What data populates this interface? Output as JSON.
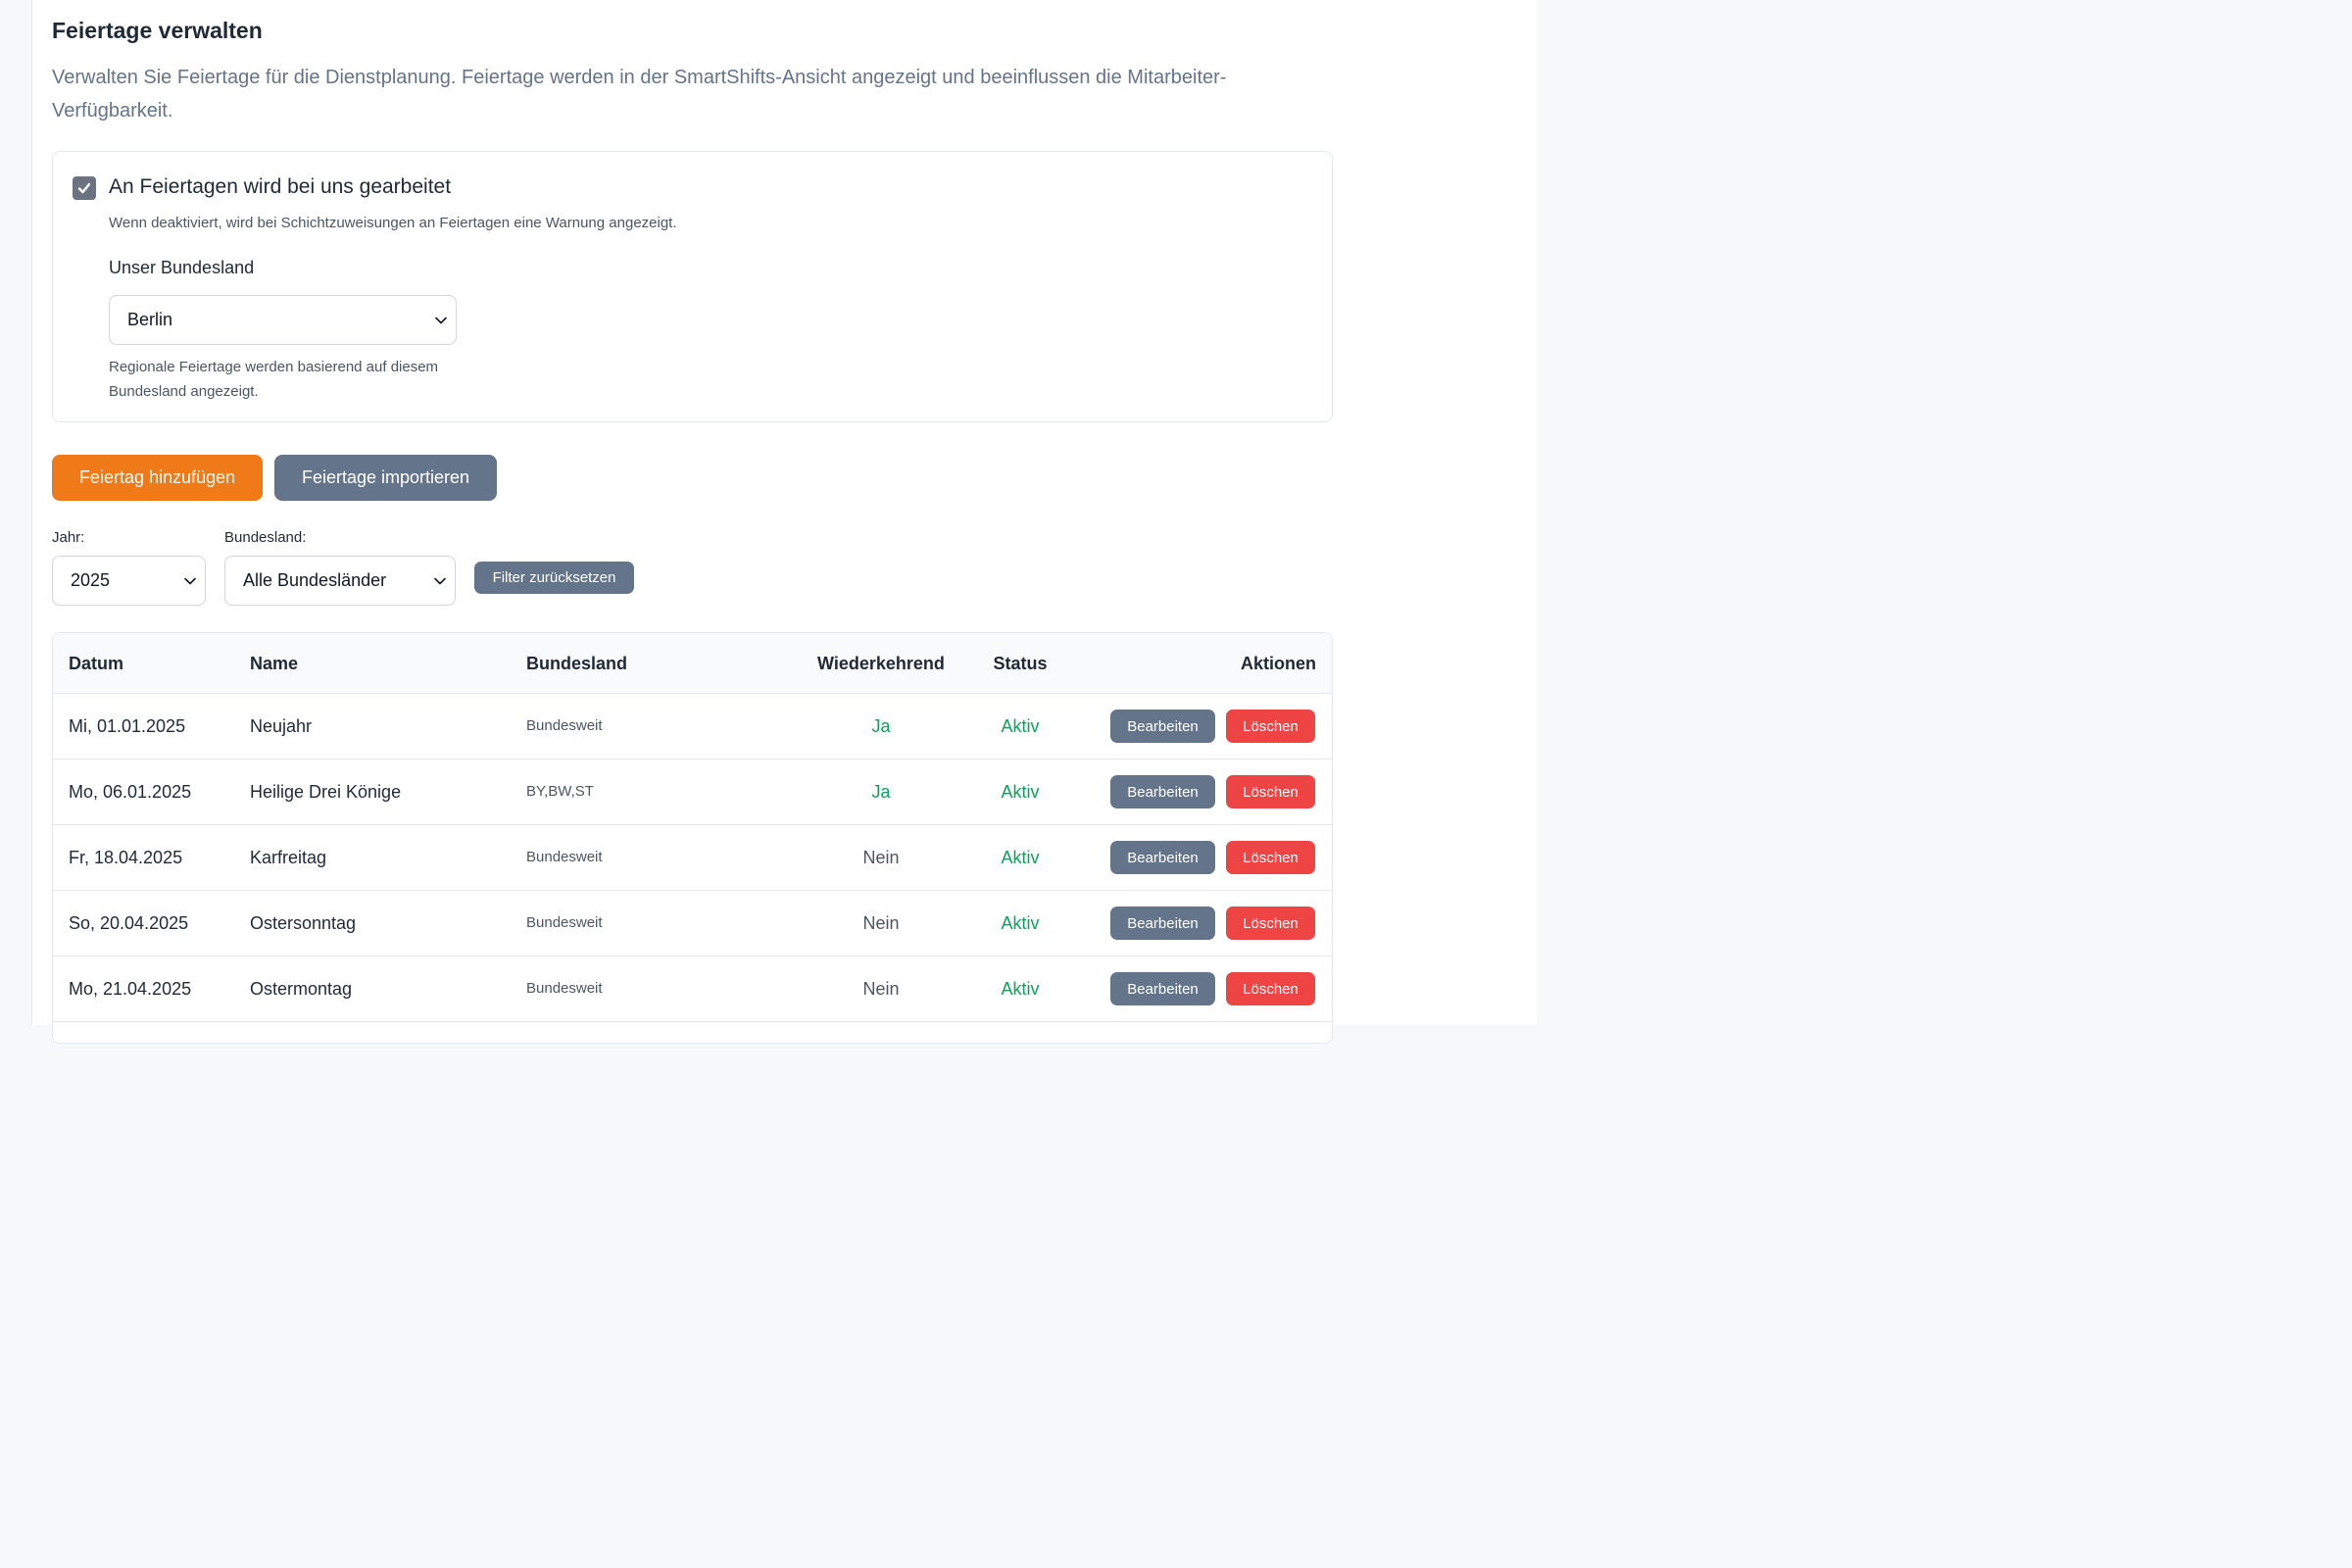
{
  "page": {
    "title": "Feiertage verwalten",
    "description": "Verwalten Sie Feiertage für die Dienstplanung. Feiertage werden in der SmartShifts-Ansicht angezeigt und beeinflussen die Mitarbeiter-Verfügbarkeit."
  },
  "settings": {
    "work_on_holidays_label": "An Feiertagen wird bei uns gearbeitet",
    "work_on_holidays_checked": true,
    "work_on_holidays_help": "Wenn deaktiviert, wird bei Schichtzuweisungen an Feiertagen eine Warnung angezeigt.",
    "state_label": "Unser Bundesland",
    "state_value": "Berlin",
    "state_help": "Regionale Feiertage werden basierend auf diesem Bundesland angezeigt."
  },
  "actions": {
    "add_label": "Feiertag hinzufügen",
    "import_label": "Feiertage importieren"
  },
  "filters": {
    "year_label": "Jahr:",
    "year_value": "2025",
    "state_label": "Bundesland:",
    "state_value": "Alle Bundesländer",
    "reset_label": "Filter zurücksetzen"
  },
  "table": {
    "headers": {
      "date": "Datum",
      "name": "Name",
      "state": "Bundesland",
      "recurring": "Wiederkehrend",
      "status": "Status",
      "actions": "Aktionen"
    },
    "edit_label": "Bearbeiten",
    "delete_label": "Löschen",
    "rows": [
      {
        "date": "Mi, 01.01.2025",
        "name": "Neujahr",
        "state": "Bundesweit",
        "recurring": "Ja",
        "status": "Aktiv"
      },
      {
        "date": "Mo, 06.01.2025",
        "name": "Heilige Drei Könige",
        "state": "BY,BW,ST",
        "recurring": "Ja",
        "status": "Aktiv"
      },
      {
        "date": "Fr, 18.04.2025",
        "name": "Karfreitag",
        "state": "Bundesweit",
        "recurring": "Nein",
        "status": "Aktiv"
      },
      {
        "date": "So, 20.04.2025",
        "name": "Ostersonntag",
        "state": "Bundesweit",
        "recurring": "Nein",
        "status": "Aktiv"
      },
      {
        "date": "Mo, 21.04.2025",
        "name": "Ostermontag",
        "state": "Bundesweit",
        "recurring": "Nein",
        "status": "Aktiv"
      }
    ]
  },
  "colors": {
    "primary": "#f07918",
    "secondary": "#64748b",
    "danger": "#ef4444",
    "success": "#10a05c"
  }
}
